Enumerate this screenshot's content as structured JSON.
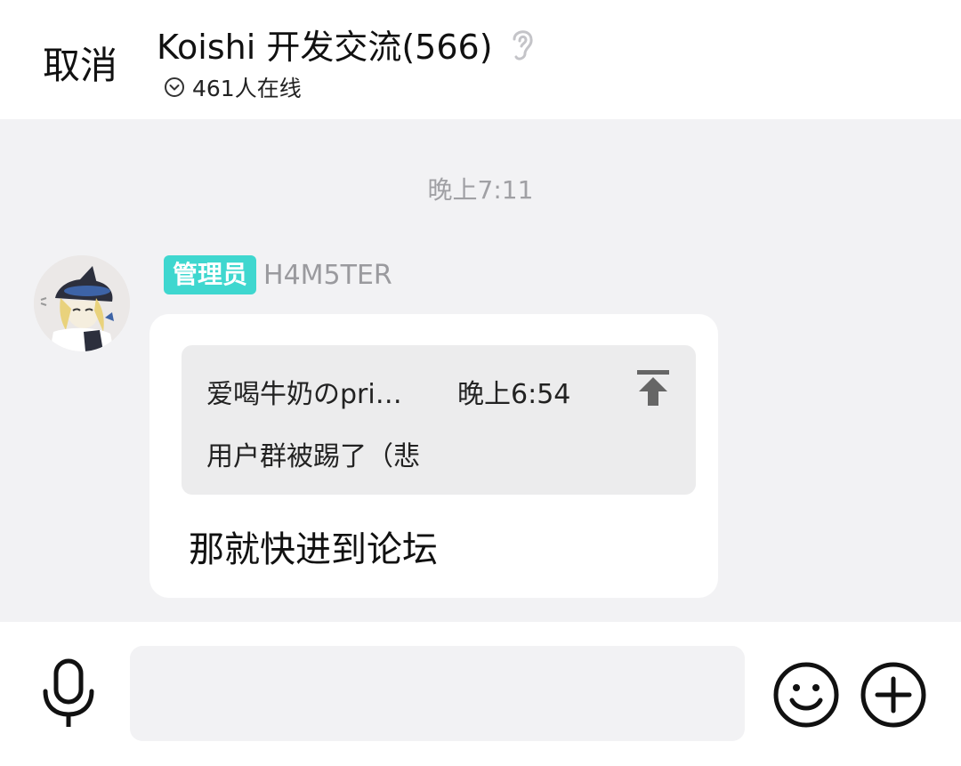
{
  "header": {
    "cancel_label": "取消",
    "title": "Koishi 开发交流(566)",
    "online_text": "461人在线",
    "icons": {
      "ear": "ear-icon",
      "online": "chevron-down-circle-icon"
    }
  },
  "chat": {
    "time_separator": "晚上7:11",
    "message": {
      "badge": "管理员",
      "sender": "H4M5TER",
      "quote": {
        "author": "爱喝牛奶のpri…",
        "time": "晚上6:54",
        "text": "用户群被踢了（悲",
        "jump_icon": "jump-to-top-icon"
      },
      "text": "那就快进到论坛"
    }
  },
  "footer": {
    "input_placeholder": "",
    "icons": {
      "mic": "microphone-icon",
      "emoji": "smiley-icon",
      "plus": "plus-circle-icon"
    }
  },
  "colors": {
    "badge_bg": "#3fd7cf",
    "chat_bg": "#f2f2f4",
    "quote_bg": "#ececed"
  }
}
